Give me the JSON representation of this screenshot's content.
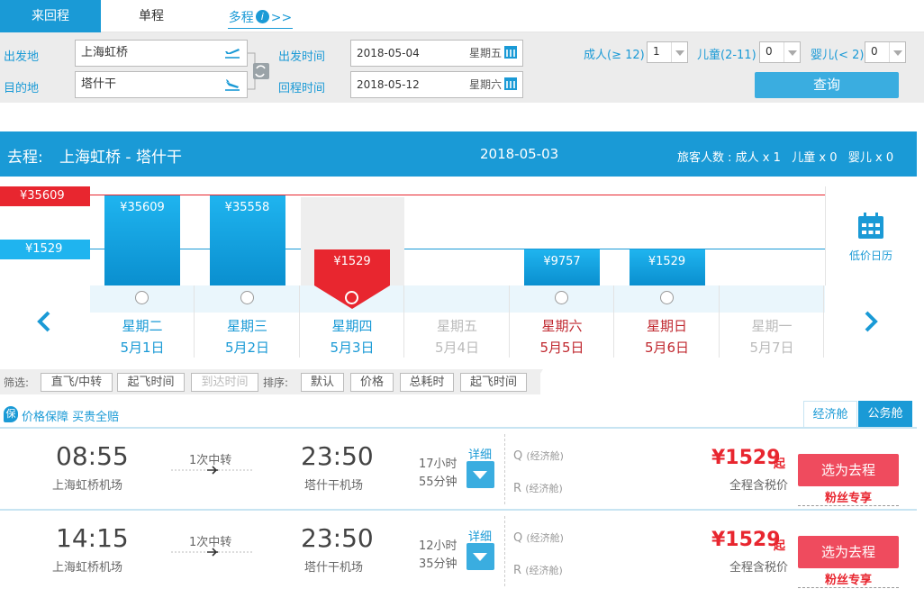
{
  "tabs": {
    "roundtrip": "来回程",
    "oneway": "单程",
    "multi": "多程",
    "multi_more": ">>"
  },
  "search": {
    "from_label": "出发地",
    "from_value": "上海虹桥",
    "to_label": "目的地",
    "to_value": "塔什干",
    "depart_label": "出发时间",
    "depart_date": "2018-05-04",
    "depart_weekday": "星期五",
    "return_label": "回程时间",
    "return_date": "2018-05-12",
    "return_weekday": "星期六",
    "adult_label": "成人(≥ 12)",
    "adult_value": "1",
    "child_label": "儿童(2-11)",
    "child_value": "0",
    "infant_label": "婴儿(< 2)",
    "infant_value": "0",
    "query_button": "查询"
  },
  "route": {
    "prefix": "去程:",
    "name": "上海虹桥 - 塔什干",
    "date": "2018-05-03",
    "passengers": "旅客人数 : 成人 x 1   儿童 x 0   婴儿 x 0"
  },
  "chart": {
    "max_label": "¥35609",
    "min_label": "¥1529",
    "lowprice_calendar": "低价日历",
    "days": [
      {
        "weekday": "星期二",
        "date": "5月1日",
        "price": "¥35609",
        "value": 35609,
        "state": "normal"
      },
      {
        "weekday": "星期三",
        "date": "5月2日",
        "price": "¥35558",
        "value": 35558,
        "state": "normal"
      },
      {
        "weekday": "星期四",
        "date": "5月3日",
        "price": "¥1529",
        "value": 1529,
        "state": "selected"
      },
      {
        "weekday": "星期五",
        "date": "5月4日",
        "price": "",
        "value": null,
        "state": "disabled"
      },
      {
        "weekday": "星期六",
        "date": "5月5日",
        "price": "¥9757",
        "value": 9757,
        "state": "weekend"
      },
      {
        "weekday": "星期日",
        "date": "5月6日",
        "price": "¥1529",
        "value": 1529,
        "state": "weekend"
      },
      {
        "weekday": "星期一",
        "date": "5月7日",
        "price": "",
        "value": null,
        "state": "disabled"
      }
    ]
  },
  "filters": {
    "filter_label": "筛选:",
    "direct": "直飞/中转",
    "depart_time": "起飞时间",
    "arrive_time": "到达时间",
    "sort_label": "排序:",
    "default": "默认",
    "price": "价格",
    "duration": "总耗时",
    "takeoff": "起飞时间"
  },
  "guarantee": {
    "badge": "保",
    "text": "价格保障 买贵全赔"
  },
  "cabin_tabs": {
    "economy": "经济舱",
    "business": "公务舱"
  },
  "flights": [
    {
      "dep_time": "08:55",
      "dep_airport": "上海虹桥机场",
      "stops": "1次中转",
      "arr_time": "23:50",
      "arr_airport": "塔什干机场",
      "duration_h": "17小时",
      "duration_m": "55分钟",
      "detail": "详细",
      "cabin_q": "Q",
      "cabin_q_name": "(经济舱)",
      "cabin_r": "R",
      "cabin_r_name": "(经济舱)",
      "price": "¥1529",
      "price_suffix": "起",
      "tax_note": "全程含税价",
      "select": "选为去程",
      "fans": "粉丝专享"
    },
    {
      "dep_time": "14:15",
      "dep_airport": "上海虹桥机场",
      "stops": "1次中转",
      "arr_time": "23:50",
      "arr_airport": "塔什干机场",
      "duration_h": "12小时",
      "duration_m": "35分钟",
      "detail": "详细",
      "cabin_q": "Q",
      "cabin_q_name": "(经济舱)",
      "cabin_r": "R",
      "cabin_r_name": "(经济舱)",
      "price": "¥1529",
      "price_suffix": "起",
      "tax_note": "全程含税价",
      "select": "选为去程",
      "fans": "粉丝专享"
    }
  ],
  "colors": {
    "accent": "#1a9ad6",
    "price_red": "#e8262f",
    "select_btn": "#ef4b5e"
  }
}
